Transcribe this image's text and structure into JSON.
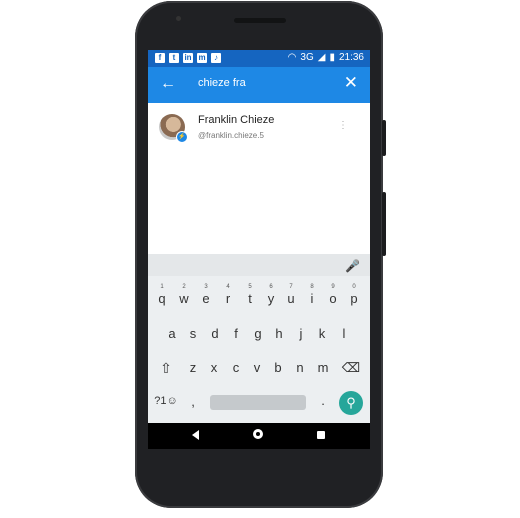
{
  "status_bar": {
    "time": "21:36",
    "network": "3G",
    "left_icons": [
      "facebook-icon",
      "twitter-icon",
      "linkedin-icon",
      "messenger-icon",
      "music-icon"
    ],
    "right_icons": [
      "headset-icon",
      "signal-icon",
      "battery-icon"
    ]
  },
  "search": {
    "query": "chieze fra"
  },
  "results": [
    {
      "name": "Franklin Chieze",
      "handle": "@franklin.chieze.5"
    }
  ],
  "keyboard": {
    "row1": [
      {
        "key": "q",
        "hint": "1"
      },
      {
        "key": "w",
        "hint": "2"
      },
      {
        "key": "e",
        "hint": "3"
      },
      {
        "key": "r",
        "hint": "4"
      },
      {
        "key": "t",
        "hint": "5"
      },
      {
        "key": "y",
        "hint": "6"
      },
      {
        "key": "u",
        "hint": "7"
      },
      {
        "key": "i",
        "hint": "8"
      },
      {
        "key": "o",
        "hint": "9"
      },
      {
        "key": "p",
        "hint": "0"
      }
    ],
    "row2": [
      "a",
      "s",
      "d",
      "f",
      "g",
      "h",
      "j",
      "k",
      "l"
    ],
    "row3": [
      "z",
      "x",
      "c",
      "v",
      "b",
      "n",
      "m"
    ],
    "symbols_label": "?1☺",
    "comma": ",",
    "period": "."
  },
  "colors": {
    "status_bar": "#1565c0",
    "app_bar": "#1e88e5",
    "keyboard_bg": "#eceff1",
    "go_key": "#26a69a"
  }
}
